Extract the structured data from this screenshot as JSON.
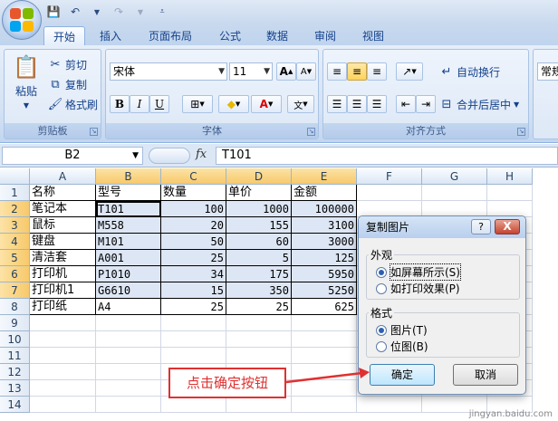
{
  "ribbon": {
    "tabs": [
      "开始",
      "插入",
      "页面布局",
      "公式",
      "数据",
      "审阅",
      "视图"
    ],
    "active_tab": "开始",
    "clipboard": {
      "paste": "粘贴",
      "cut": "剪切",
      "copy": "复制",
      "format_painter": "格式刷",
      "label": "剪贴板"
    },
    "font": {
      "name": "宋体",
      "size": "11",
      "label": "字体",
      "grow": "A",
      "shrink": "A"
    },
    "alignment": {
      "wrap": "自动换行",
      "merge": "合并后居中",
      "label": "对齐方式"
    },
    "number": {
      "format": "常规"
    }
  },
  "formula_bar": {
    "name_box": "B2",
    "fx": "fx",
    "formula": "T101"
  },
  "columns": [
    "A",
    "B",
    "C",
    "D",
    "E",
    "F",
    "G",
    "H"
  ],
  "rows": [
    "1",
    "2",
    "3",
    "4",
    "5",
    "6",
    "7",
    "8",
    "9",
    "10",
    "11",
    "12",
    "13",
    "14"
  ],
  "table": [
    [
      "名称",
      "型号",
      "数量",
      "单价",
      "金额"
    ],
    [
      "笔记本",
      "T101",
      "100",
      "1000",
      "100000"
    ],
    [
      "鼠标",
      "M558",
      "20",
      "155",
      "3100"
    ],
    [
      "键盘",
      "M101",
      "50",
      "60",
      "3000"
    ],
    [
      "清洁套",
      "A001",
      "25",
      "5",
      "125"
    ],
    [
      "打印机",
      "P1010",
      "34",
      "175",
      "5950"
    ],
    [
      "打印机1",
      "G6610",
      "15",
      "350",
      "5250"
    ],
    [
      "打印纸",
      "A4",
      "25",
      "25",
      "625"
    ]
  ],
  "dialog": {
    "title": "复制图片",
    "help": "?",
    "close": "X",
    "appearance_label": "外观",
    "appearance_options": [
      "如屏幕所示(S)",
      "如打印效果(P)"
    ],
    "format_label": "格式",
    "format_options": [
      "图片(T)",
      "位图(B)"
    ],
    "ok": "确定",
    "cancel": "取消"
  },
  "callout": "点击确定按钮",
  "watermark": "jingyan.baidu.com",
  "colors": {
    "accent": "#e03030",
    "ribbon": "#d2e1f4",
    "selection": "#f7c96b"
  }
}
